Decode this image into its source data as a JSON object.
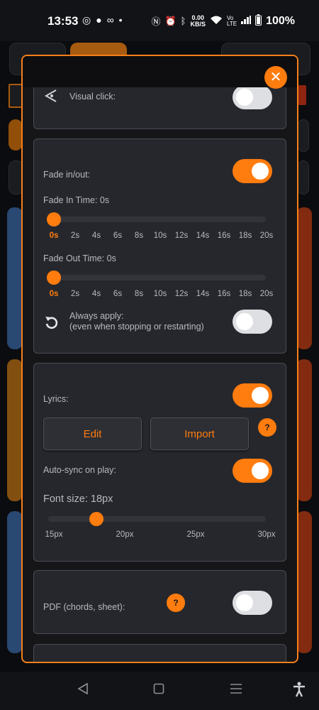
{
  "status_bar": {
    "time": "13:53",
    "speed_value": "0.00",
    "speed_unit": "KB/S",
    "battery": "100%",
    "icons": [
      "whatsapp-icon",
      "chat-icon",
      "voicemail-icon",
      "dot-icon",
      "nfc-icon",
      "alarm-icon",
      "bluetooth-icon",
      "wifi-icon",
      "volte-icon",
      "signal-icon",
      "battery-icon"
    ]
  },
  "modal": {
    "close_label": "✕",
    "visual_click": {
      "label": "Visual click:",
      "enabled": false
    },
    "fade": {
      "label": "Fade in/out:",
      "enabled": true,
      "fade_in_label": "Fade In Time: 0s",
      "fade_in_value": 0,
      "fade_out_label": "Fade Out Time: 0s",
      "fade_out_value": 0,
      "ticks": [
        "0s",
        "2s",
        "4s",
        "6s",
        "8s",
        "10s",
        "12s",
        "14s",
        "16s",
        "18s",
        "20s"
      ],
      "always_apply_label": "Always apply:",
      "always_apply_sub": "(even when stopping or restarting)",
      "always_apply_enabled": false
    },
    "lyrics": {
      "label": "Lyrics:",
      "enabled": true,
      "edit_label": "Edit",
      "import_label": "Import",
      "help_label": "?",
      "auto_sync_label": "Auto-sync on play:",
      "auto_sync_enabled": true,
      "font_size_label": "Font size: 18px",
      "font_size_value": 18,
      "font_ticks": [
        "15px",
        "20px",
        "25px",
        "30px"
      ]
    },
    "pdf": {
      "label": "PDF (chords, sheet):",
      "help_label": "?",
      "enabled": false
    }
  },
  "colors": {
    "accent": "#ff7c0f",
    "card": "#26272c",
    "border": "#4a4c54"
  }
}
